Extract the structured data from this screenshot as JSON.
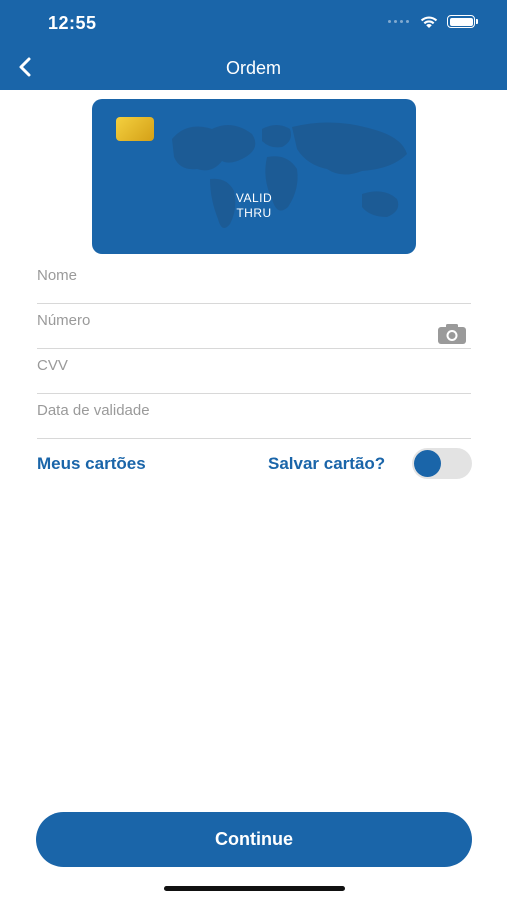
{
  "status_bar": {
    "time": "12:55"
  },
  "nav": {
    "title": "Ordem"
  },
  "card": {
    "valid_line1": "VALID",
    "valid_line2": "THRU"
  },
  "form": {
    "name_label": "Nome",
    "number_label": "Número",
    "cvv_label": "CVV",
    "expiry_label": "Data de validade"
  },
  "options": {
    "my_cards_label": "Meus cartões",
    "save_card_label": "Salvar cartão?",
    "save_card_toggle_on": false
  },
  "actions": {
    "continue_label": "Continue"
  },
  "colors": {
    "brand": "#1a65a9",
    "chip": "#f4d03f",
    "divider": "#d8d8d8"
  },
  "icons": {
    "back": "chevron-left-icon",
    "camera": "camera-icon",
    "wifi": "wifi-icon",
    "battery": "battery-icon"
  }
}
